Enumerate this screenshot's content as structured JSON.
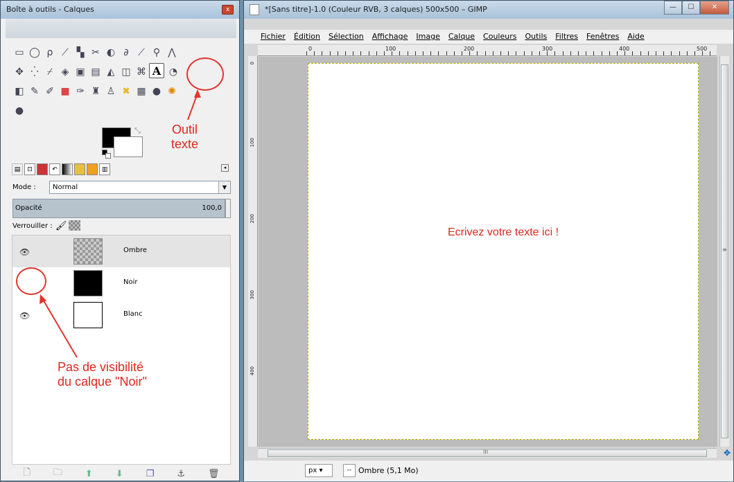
{
  "toolbox": {
    "title": "Boîte à outils - Calques",
    "close": "x",
    "selected_tool": "A",
    "mode_label": "Mode :",
    "mode_value": "Normal",
    "opacity_label": "Opacité",
    "opacity_value": "100,0",
    "lock_label": "Verrouiller :",
    "layers": [
      {
        "name": "Ombre",
        "visible": true,
        "selected": true
      },
      {
        "name": "Noir",
        "visible": false,
        "selected": false
      },
      {
        "name": "Blanc",
        "visible": true,
        "selected": false
      }
    ]
  },
  "annotations": {
    "tool_label_line1": "Outil",
    "tool_label_line2": "texte",
    "visibility_line1": "Pas de visibilité",
    "visibility_line2": "du calque \"Noir\""
  },
  "image_window": {
    "title": "*[Sans titre]-1.0 (Couleur RVB, 3 calques) 500x500 – GIMP",
    "menu": [
      "Fichier",
      "Édition",
      "Sélection",
      "Affichage",
      "Image",
      "Calque",
      "Couleurs",
      "Outils",
      "Filtres",
      "Fenêtres",
      "Aide"
    ],
    "ruler_labels": [
      "0",
      "100",
      "200",
      "300",
      "400",
      "500"
    ],
    "vruler_labels": [
      "0",
      "100",
      "200",
      "300",
      "400"
    ],
    "canvas_text": "Ecrivez votre texte ici !",
    "unit": "px",
    "status": "Ombre (5,1 Mo)",
    "hscroll_mark": "III",
    "vscroll_mark": "≡"
  }
}
